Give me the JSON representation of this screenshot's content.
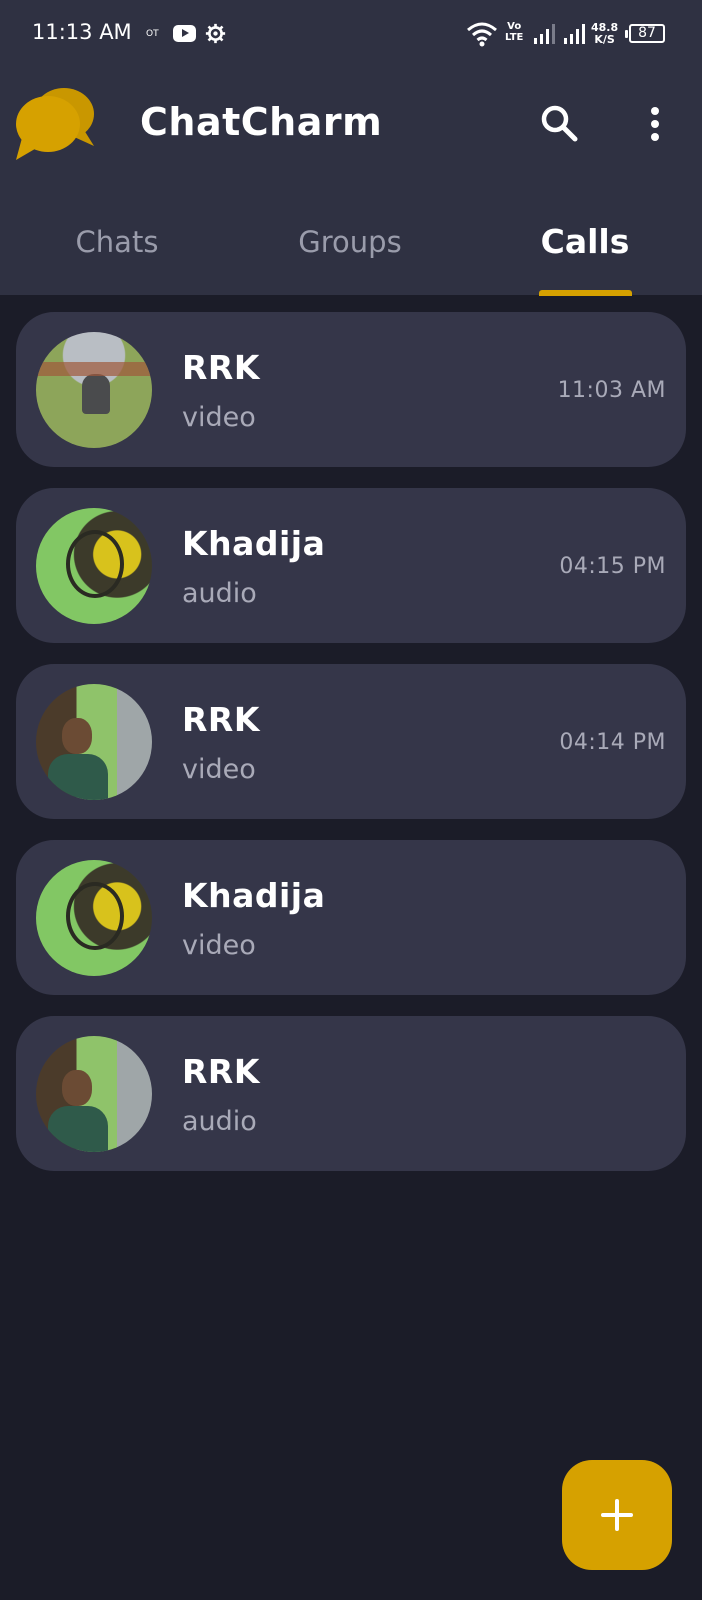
{
  "status_bar": {
    "time": "11:13 AM",
    "ot": "OT",
    "volte": "Vo\nLTE",
    "speed": "48.8\nK/S",
    "battery": "87",
    "icons": [
      "youtube-icon",
      "gear-icon",
      "wifi-icon",
      "signal-icon",
      "battery-icon"
    ]
  },
  "app_bar": {
    "title": "ChatCharm",
    "logo_icon": "chat-bubbles-logo",
    "search_icon": "search-icon",
    "more_icon": "more-vertical-icon"
  },
  "tabs": [
    {
      "label": "Chats",
      "active": false
    },
    {
      "label": "Groups",
      "active": false
    },
    {
      "label": "Calls",
      "active": true
    }
  ],
  "calls": [
    {
      "name": "RRK",
      "type": "video",
      "time": "11:03 AM"
    },
    {
      "name": "Khadija",
      "type": "audio",
      "time": "04:15 PM"
    },
    {
      "name": "RRK",
      "type": "video",
      "time": "04:14 PM"
    },
    {
      "name": "Khadija",
      "type": "video",
      "time": ""
    },
    {
      "name": "RRK",
      "type": "audio",
      "time": ""
    }
  ],
  "fab": {
    "icon": "plus-icon",
    "label": "+"
  },
  "colors": {
    "background": "#1b1c28",
    "app_bar": "#2f3142",
    "card": "#353649",
    "accent": "#d6a100",
    "muted_text": "#a9aab8"
  }
}
